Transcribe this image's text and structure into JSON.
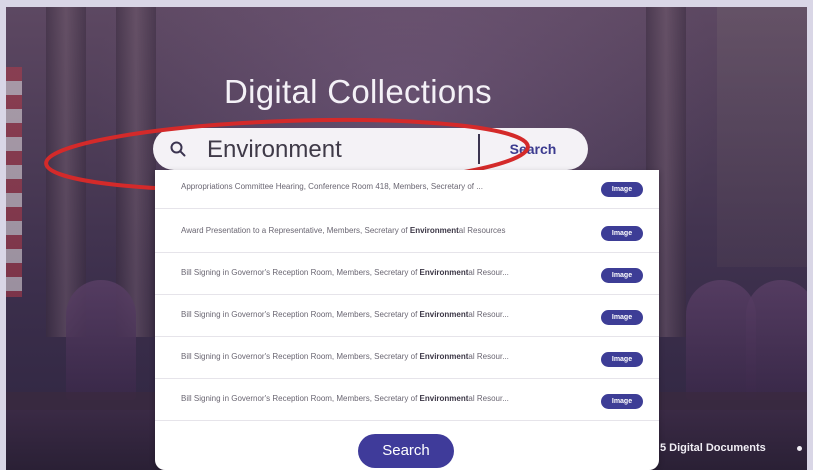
{
  "hero": {
    "title": "Digital Collections"
  },
  "search": {
    "value": "Environment",
    "button_label": "Search",
    "bottom_button_label": "Search"
  },
  "results": [
    {
      "prefix": "Appropriations Committee Hearing, Conference Room 418, Members, Secretary of ...",
      "highlight": "",
      "suffix": "",
      "badge": "Image"
    },
    {
      "prefix": "Award Presentation to a Representative, Members, Secretary of ",
      "highlight": "Environment",
      "suffix": "al Resources",
      "badge": "Image"
    },
    {
      "prefix": "Bill Signing in Governor's Reception Room, Members, Secretary of ",
      "highlight": "Environment",
      "suffix": "al Resour...",
      "badge": "Image"
    },
    {
      "prefix": "Bill Signing in Governor's Reception Room, Members, Secretary of ",
      "highlight": "Environment",
      "suffix": "al Resour...",
      "badge": "Image"
    },
    {
      "prefix": "Bill Signing in Governor's Reception Room, Members, Secretary of ",
      "highlight": "Environment",
      "suffix": "al Resour...",
      "badge": "Image"
    },
    {
      "prefix": "Bill Signing in Governor's Reception Room, Members, Secretary of ",
      "highlight": "Environment",
      "suffix": "al Resour...",
      "badge": "Image"
    }
  ],
  "footer": {
    "doc_count": "5 Digital Documents"
  },
  "colors": {
    "accent": "#3f3b9a",
    "annotation": "#d42a2a"
  },
  "icons": {
    "search": "search-icon"
  }
}
